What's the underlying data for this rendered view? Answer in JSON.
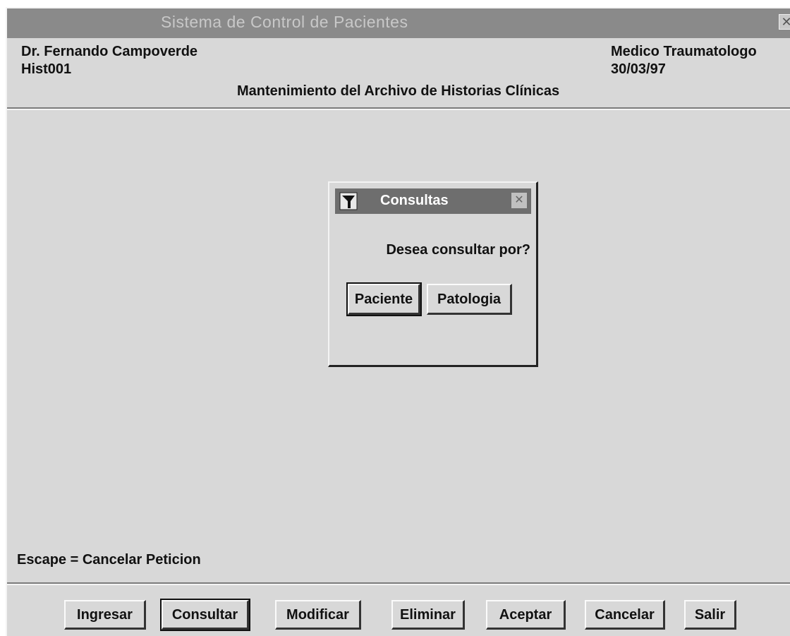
{
  "window": {
    "title": "Sistema de Control de Pacientes",
    "close_glyph": "✕"
  },
  "header": {
    "doctor_name": "Dr. Fernando Campoverde",
    "form_code": "Hist001",
    "specialty": "Medico Traumatologo",
    "date": "30/03/97",
    "form_title": "Mantenimiento del Archivo de Historias Clínicas"
  },
  "dialog": {
    "title": "Consultas",
    "message": "Desea consultar por?",
    "buttons": [
      "Paciente",
      "Patologia"
    ],
    "close_glyph": "✕"
  },
  "footer": {
    "hint": "Escape = Cancelar Peticion"
  },
  "toolbar": {
    "buttons": [
      "Ingresar",
      "Consultar",
      "Modificar",
      "Eliminar",
      "Aceptar",
      "Cancelar",
      "Salir"
    ]
  },
  "icons": {
    "window_close": "close-icon",
    "dialog_app": "app-icon",
    "dialog_close": "close-icon"
  }
}
